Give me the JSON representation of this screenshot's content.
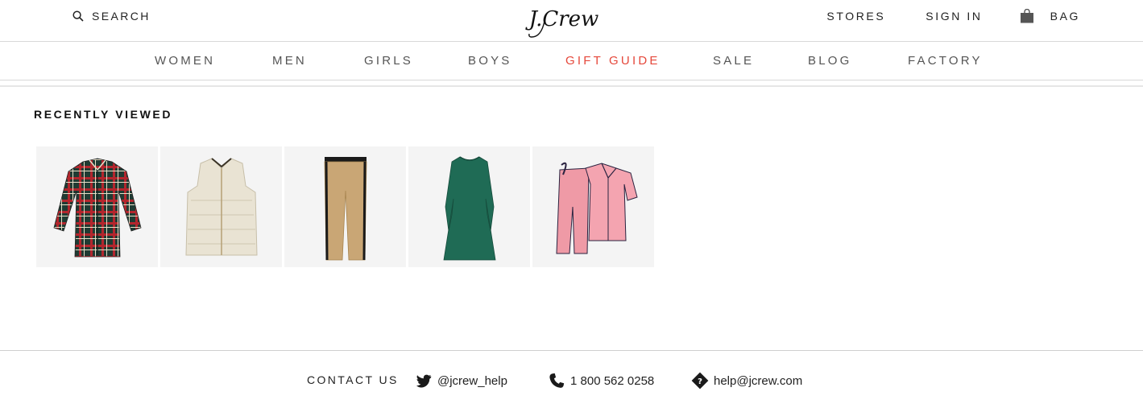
{
  "header": {
    "search_label": "SEARCH",
    "logo_text": "J.Crew",
    "stores_label": "STORES",
    "signin_label": "SIGN IN",
    "bag_label": "BAG"
  },
  "nav": {
    "items": [
      {
        "label": "WOMEN"
      },
      {
        "label": "MEN"
      },
      {
        "label": "GIRLS"
      },
      {
        "label": "BOYS"
      },
      {
        "label": "GIFT GUIDE",
        "highlight": true
      },
      {
        "label": "SALE"
      },
      {
        "label": "BLOG"
      },
      {
        "label": "FACTORY"
      }
    ],
    "highlight_color": "#e5483b"
  },
  "recently_viewed": {
    "title": "RECENTLY VIEWED",
    "products": [
      {
        "icon": "plaid-shirt-image"
      },
      {
        "icon": "puffer-vest-image"
      },
      {
        "icon": "khaki-pants-image"
      },
      {
        "icon": "green-dress-image"
      },
      {
        "icon": "pink-pajamas-image"
      }
    ]
  },
  "footer": {
    "contact_label": "CONTACT US",
    "twitter": "@jcrew_help",
    "phone": "1 800 562 0258",
    "email": "help@jcrew.com"
  }
}
